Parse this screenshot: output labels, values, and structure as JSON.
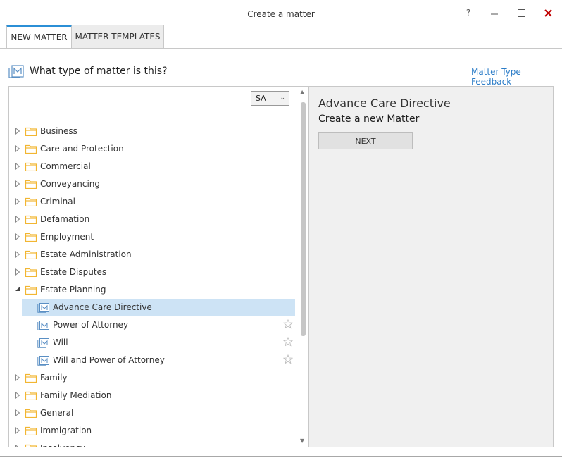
{
  "window": {
    "title": "Create a matter",
    "help_glyph": "?",
    "minimize_glyph": "—",
    "maximize_glyph": "☐",
    "close_glyph": "✕"
  },
  "tabs": [
    {
      "label": "NEW MATTER",
      "active": true
    },
    {
      "label": "MATTER TEMPLATES",
      "active": false
    }
  ],
  "heading": {
    "text": "What type of matter is this?",
    "feedback_link": "Matter Type Feedback"
  },
  "state_select": {
    "value": "SA"
  },
  "tree": {
    "categories_before": [
      {
        "label": "Business"
      },
      {
        "label": "Care and Protection"
      },
      {
        "label": "Commercial"
      },
      {
        "label": "Conveyancing"
      },
      {
        "label": "Criminal"
      },
      {
        "label": "Defamation"
      },
      {
        "label": "Employment"
      },
      {
        "label": "Estate Administration"
      },
      {
        "label": "Estate Disputes"
      }
    ],
    "expanded": {
      "label": "Estate Planning",
      "children": [
        {
          "label": "Advance Care Directive",
          "selected": true
        },
        {
          "label": "Power of Attorney",
          "selected": false
        },
        {
          "label": "Will",
          "selected": false
        },
        {
          "label": "Will and Power of Attorney",
          "selected": false
        }
      ]
    },
    "categories_after": [
      {
        "label": "Family"
      },
      {
        "label": "Family Mediation"
      },
      {
        "label": "General"
      },
      {
        "label": "Immigration"
      },
      {
        "label": "Insolvency"
      }
    ]
  },
  "detail": {
    "title": "Advance Care Directive",
    "subtitle": "Create a new Matter",
    "next_label": "NEXT"
  },
  "colors": {
    "accent": "#2b8fd6",
    "link": "#2b7cc7",
    "folder": "#f2b632",
    "selection": "#cde3f5",
    "close": "#c00000"
  },
  "icons": {
    "heading": "matter-icon",
    "folder": "folder-icon",
    "child": "matter-icon",
    "star": "star-outline-icon",
    "collapsed": "triangle-right-icon",
    "expanded": "triangle-down-icon"
  }
}
